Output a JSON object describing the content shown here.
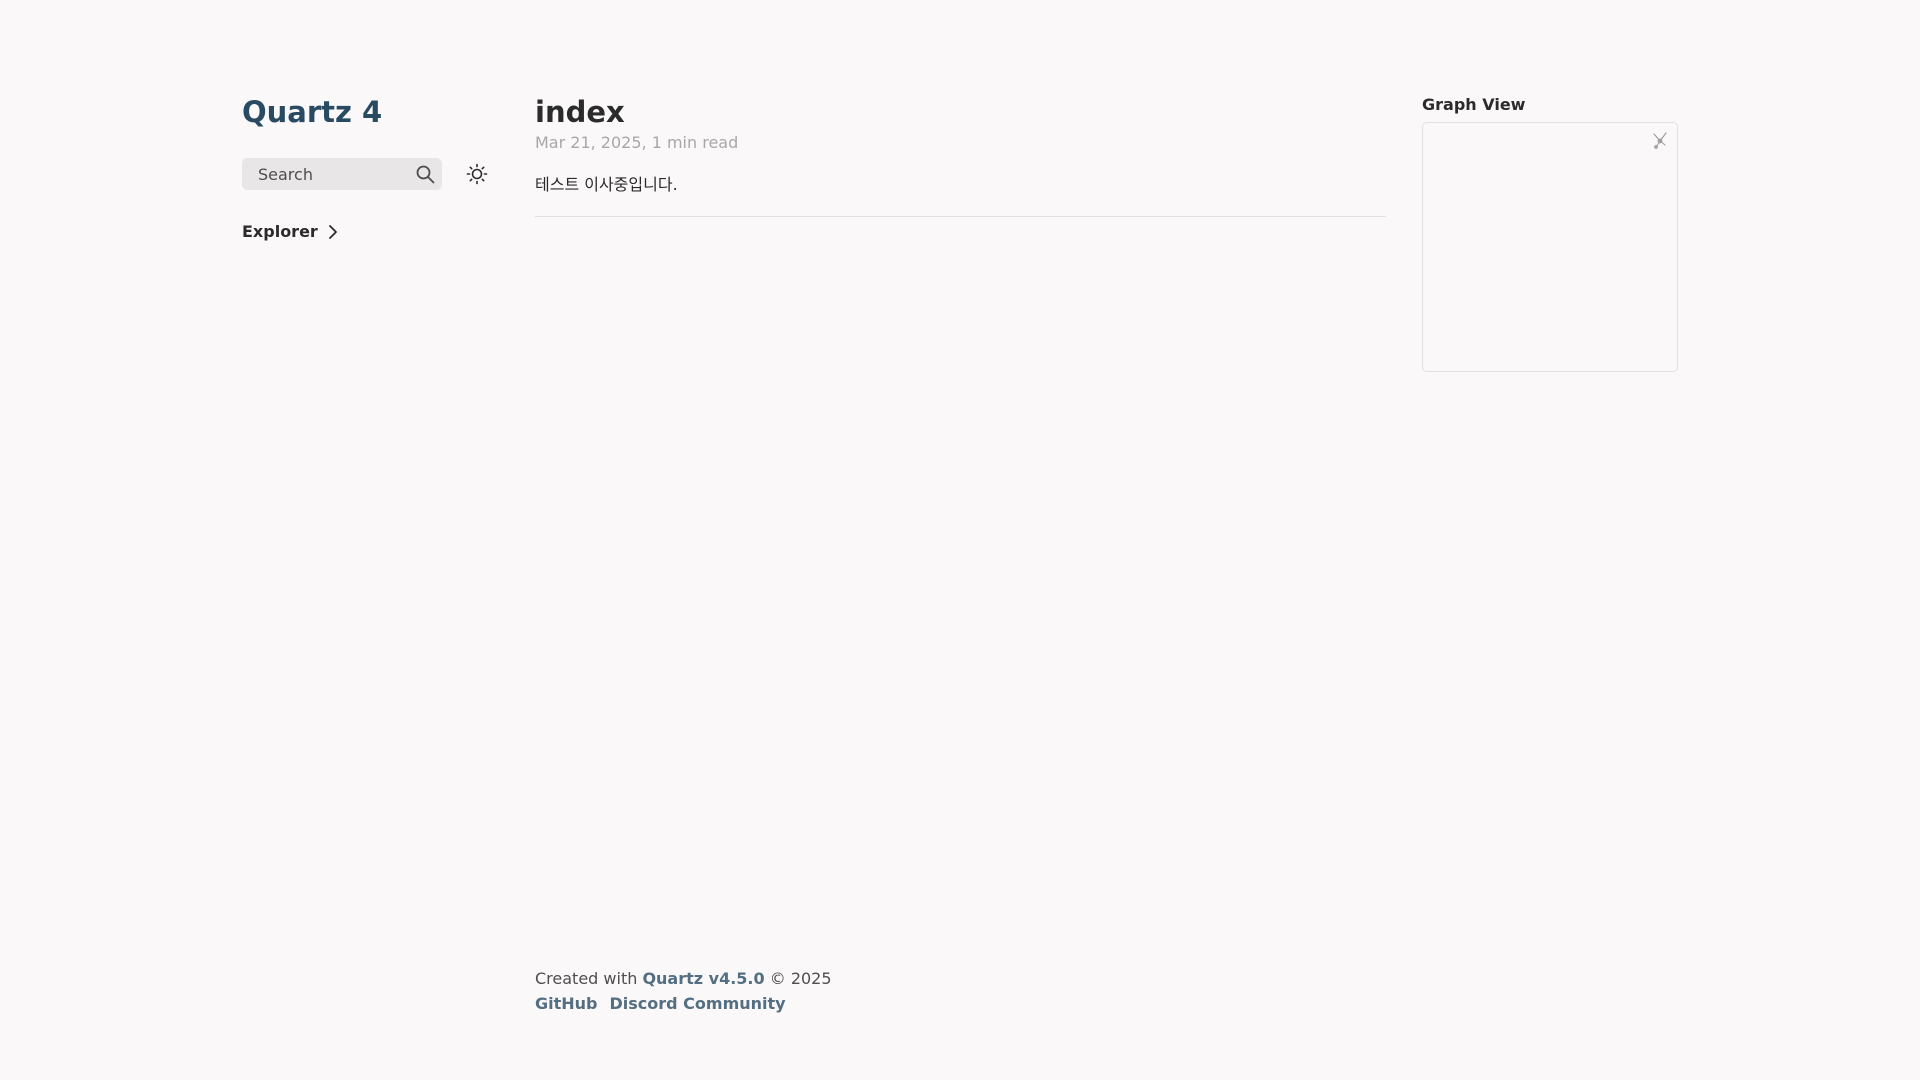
{
  "site": {
    "title": "Quartz 4"
  },
  "search": {
    "label": "Search",
    "icon": "search-icon"
  },
  "darkmode": {
    "icon": "sun-icon"
  },
  "explorer": {
    "label": "Explorer",
    "icon": "chevron-right-icon"
  },
  "article": {
    "title": "index",
    "date": "Mar 21, 2025",
    "separator": ", ",
    "read_time": "1 min read",
    "body": "테스트 이사중입니다."
  },
  "graph": {
    "title": "Graph View",
    "icon": "global-graph-icon"
  },
  "footer": {
    "created_prefix": "Created with ",
    "quartz_link": "Quartz v4.5.0",
    "copyright": " © 2025",
    "links": [
      {
        "label": "GitHub"
      },
      {
        "label": "Discord Community"
      }
    ]
  },
  "colors": {
    "background": "#faf8f8",
    "accent": "#284b63",
    "link": "#546e82",
    "muted": "#a8a8a8",
    "text": "#2b2b2b"
  }
}
